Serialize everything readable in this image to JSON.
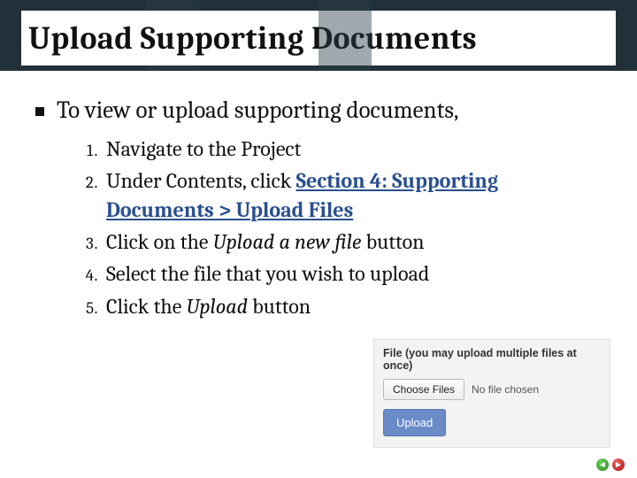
{
  "title": "Upload Supporting Documents",
  "lead": "To view or upload supporting documents,",
  "steps": {
    "s1": "Navigate to the Project",
    "s2_pre": "Under Contents, click ",
    "s2_link": "Section 4: Supporting Documents > Upload Files",
    "s3_pre": "Click on the ",
    "s3_em": "Upload a new file",
    "s3_post": " button",
    "s4": "Select the file that you wish to upload",
    "s5_pre": "Click the ",
    "s5_em": "Upload",
    "s5_post": " button"
  },
  "panel": {
    "label": "File (you may upload multiple files at once)",
    "choose": "Choose Files",
    "status": "No file chosen",
    "upload": "Upload"
  },
  "nav": {
    "prev": "◄",
    "next": "►"
  }
}
